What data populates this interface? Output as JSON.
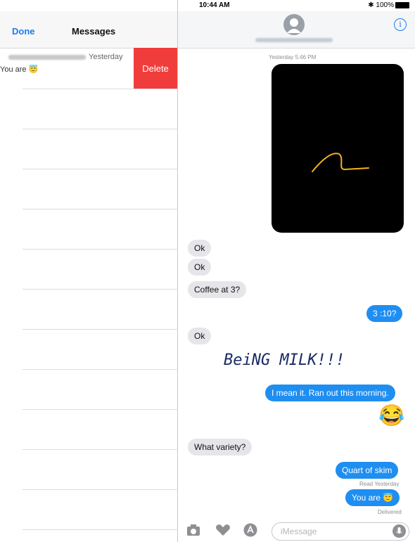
{
  "status_bar": {
    "device": "iPad",
    "time": "10:44 AM",
    "battery": "100%"
  },
  "left_pane": {
    "done_label": "Done",
    "title": "Messages",
    "conversation": {
      "time": "Yesterday",
      "preview": "You are 😇",
      "delete_label": "Delete"
    }
  },
  "conversation_header": {
    "info_icon": "info-icon"
  },
  "thread": {
    "timestamp": "Yesterday 5:46 PM",
    "messages": [
      {
        "side": "left",
        "text": "Ok"
      },
      {
        "side": "left",
        "text": "Ok"
      },
      {
        "side": "left",
        "text": "Coffee at 3?"
      },
      {
        "side": "right",
        "text": "3 :10?"
      },
      {
        "side": "left",
        "text": "Ok"
      },
      {
        "side": "handwriting",
        "text": "BeiNG MILK!!!"
      },
      {
        "side": "right",
        "text": "I mean it. Ran out this morning."
      },
      {
        "side": "emoji",
        "text": "😂"
      },
      {
        "side": "left",
        "text": "What variety?"
      },
      {
        "side": "right",
        "text": "Quart of skim"
      },
      {
        "side": "right",
        "text": "You are 😇"
      }
    ],
    "read_receipt": "Read Yesterday",
    "delivered": "Delivered"
  },
  "input_bar": {
    "placeholder": "iMessage"
  },
  "colors": {
    "accent": "#1a7cf3",
    "bubble_blue": "#1f8ef1",
    "bubble_gray": "#e6e6ea",
    "delete": "#f13c3c",
    "drawing_stroke": "#f5b21b"
  }
}
